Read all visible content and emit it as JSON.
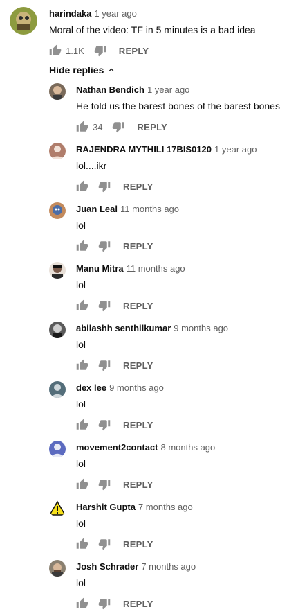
{
  "top_comment": {
    "author": "harindaka",
    "time": "1 year ago",
    "text": "Moral of the video: TF in 5 minutes is a bad idea",
    "likes": "1.1K",
    "reply_label": "REPLY"
  },
  "hide_replies_label": "Hide replies",
  "replies": [
    {
      "author": "Nathan Bendich",
      "time": "1 year ago",
      "text": "He told us the barest bones of the barest bones",
      "likes": "34",
      "reply_label": "REPLY"
    },
    {
      "author": "RAJENDRA MYTHILI 17BIS0120",
      "time": "1 year ago",
      "text": "lol....ikr",
      "likes": "",
      "reply_label": "REPLY"
    },
    {
      "author": "Juan Leal",
      "time": "11 months ago",
      "text": "lol",
      "likes": "",
      "reply_label": "REPLY"
    },
    {
      "author": "Manu Mitra",
      "time": "11 months ago",
      "text": "lol",
      "likes": "",
      "reply_label": "REPLY"
    },
    {
      "author": "abilashh senthilkumar",
      "time": "9 months ago",
      "text": "lol",
      "likes": "",
      "reply_label": "REPLY"
    },
    {
      "author": "dex lee",
      "time": "9 months ago",
      "text": "lol",
      "likes": "",
      "reply_label": "REPLY"
    },
    {
      "author": "movement2contact",
      "time": "8 months ago",
      "text": "lol",
      "likes": "",
      "reply_label": "REPLY"
    },
    {
      "author": "Harshit Gupta",
      "time": "7 months ago",
      "text": "lol",
      "likes": "",
      "reply_label": "REPLY"
    },
    {
      "author": "Josh Schrader",
      "time": "7 months ago",
      "text": "lol",
      "likes": "",
      "reply_label": "REPLY"
    }
  ],
  "icons": {
    "like": "thumbs-up-icon",
    "dislike": "thumbs-down-icon",
    "hide": "chevron-up-icon"
  },
  "colors": {
    "text": "#0f0f0f",
    "secondary": "#606060",
    "icon": "#909090"
  }
}
